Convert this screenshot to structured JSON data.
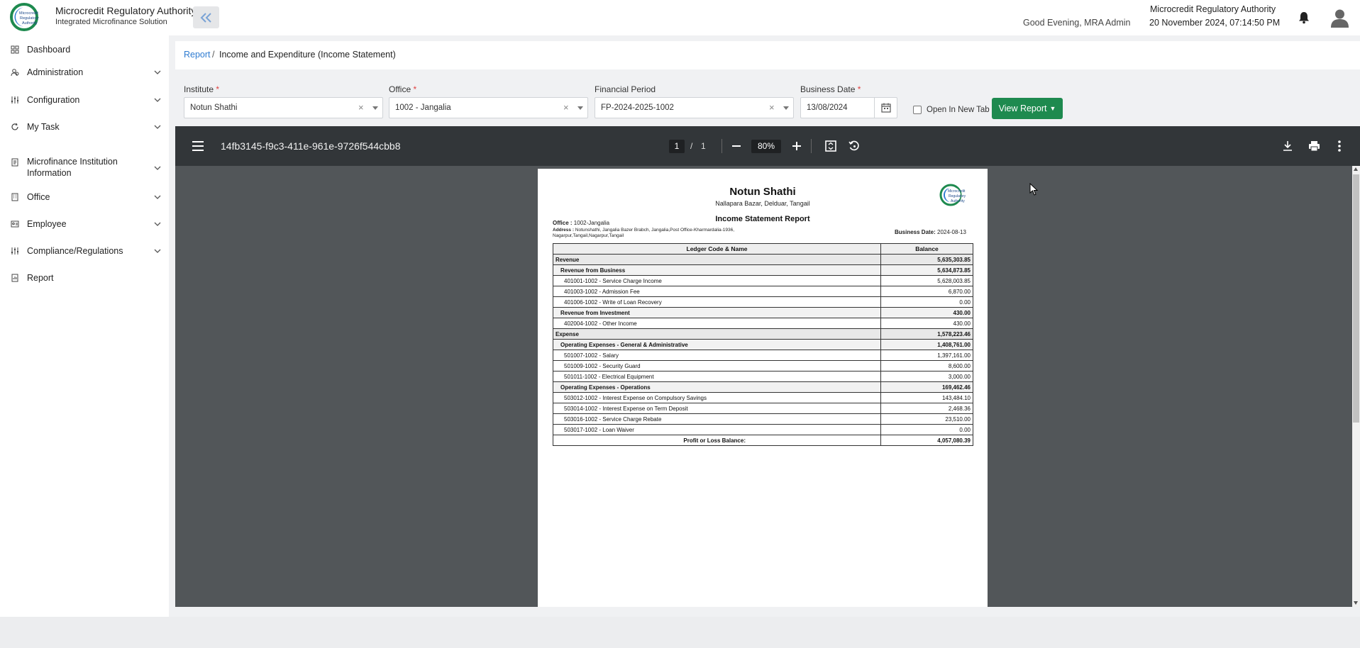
{
  "app": {
    "title": "Microcredit Regulatory Authority",
    "subtitle": "Integrated Microfinance Solution",
    "logo_text": "Microcredit Regulatory Authority"
  },
  "header": {
    "greeting": "Good Evening, MRA Admin",
    "authority": "Microcredit Regulatory Authority",
    "datetime": "20 November 2024, 07:14:50 PM"
  },
  "sidebar": {
    "items": [
      {
        "label": "Dashboard",
        "icon": "dashboard-icon",
        "has_submenu": false
      },
      {
        "label": "Administration",
        "icon": "users-icon",
        "has_submenu": true
      },
      {
        "label": "Configuration",
        "icon": "sliders-icon",
        "has_submenu": true
      },
      {
        "label": "My Task",
        "icon": "refresh-icon",
        "has_submenu": true
      },
      {
        "label": "Microfinance Institution Information",
        "icon": "document-icon",
        "has_submenu": true
      },
      {
        "label": "Office",
        "icon": "building-icon",
        "has_submenu": true
      },
      {
        "label": "Employee",
        "icon": "id-card-icon",
        "has_submenu": true
      },
      {
        "label": "Compliance/Regulations",
        "icon": "sliders-icon",
        "has_submenu": true
      },
      {
        "label": "Report",
        "icon": "report-icon",
        "has_submenu": false
      }
    ]
  },
  "breadcrumb": {
    "link": "Report",
    "separator": "/",
    "current": "Income and Expenditure (Income Statement)"
  },
  "filters": {
    "institute": {
      "label": "Institute",
      "required": "*",
      "value": "Notun Shathi"
    },
    "office": {
      "label": "Office",
      "required": "*",
      "value": "1002 - Jangalia"
    },
    "financial_period": {
      "label": "Financial Period",
      "value": "FP-2024-2025-1002"
    },
    "business_date": {
      "label": "Business Date",
      "required": "*",
      "value": "13/08/2024"
    },
    "open_new_tab": {
      "label": "Open In New Tab",
      "checked": false
    },
    "view_report": "View Report"
  },
  "viewer": {
    "doc_title": "14fb3145-f9c3-411e-961e-9726f544cbb8",
    "page_current": "1",
    "page_separator": "/",
    "page_total": "1",
    "zoom": "80%"
  },
  "report": {
    "name": "Notun Shathi",
    "address_line": "Nallapara Bazar, Delduar, Tangail",
    "title": "Income Statement Report",
    "office_label": "Office :",
    "office_value": "1002-Jangalia",
    "address_label": "Address :",
    "address_value": "Notunshathi, Jangalia Bazer Brabch, Jangalia,Post Office-Kharmardalia-1936, Nagarpur,Tangail,Nagarpur,Tangail",
    "business_date_label": "Business Date:",
    "business_date_value": "2024-08-13",
    "col_ledger": "Ledger Code & Name",
    "col_balance": "Balance",
    "rows": [
      {
        "level": 0,
        "name": "Revenue",
        "amount": "5,635,303.85"
      },
      {
        "level": 1,
        "name": "Revenue from Business",
        "amount": "5,634,873.85"
      },
      {
        "level": 2,
        "name": "401001-1002 - Service Charge Income",
        "amount": "5,628,003.85"
      },
      {
        "level": 2,
        "name": "401003-1002 - Admission Fee",
        "amount": "6,870.00"
      },
      {
        "level": 2,
        "name": "401006-1002 - Write of Loan Recovery",
        "amount": "0.00"
      },
      {
        "level": 1,
        "name": "Revenue from Investment",
        "amount": "430.00"
      },
      {
        "level": 2,
        "name": "402004-1002 - Other Income",
        "amount": "430.00"
      },
      {
        "level": 0,
        "name": "Expense",
        "amount": "1,578,223.46"
      },
      {
        "level": 1,
        "name": "Operating Expenses - General & Administrative",
        "amount": "1,408,761.00"
      },
      {
        "level": 2,
        "name": "501007-1002 - Salary",
        "amount": "1,397,161.00"
      },
      {
        "level": 2,
        "name": "501009-1002 - Security Guard",
        "amount": "8,600.00"
      },
      {
        "level": 2,
        "name": "501011-1002 - Electrical Equipment",
        "amount": "3,000.00"
      },
      {
        "level": 1,
        "name": "Operating Expenses - Operations",
        "amount": "169,462.46"
      },
      {
        "level": 2,
        "name": "503012-1002 - Interest Expense on Compulsory Savings",
        "amount": "143,484.10"
      },
      {
        "level": 2,
        "name": "503014-1002 - Interest Expense on Term Deposit",
        "amount": "2,468.36"
      },
      {
        "level": 2,
        "name": "503016-1002 - Service Charge Rebate",
        "amount": "23,510.00"
      },
      {
        "level": 2,
        "name": "503017-1002 - Loan Waiver",
        "amount": "0.00"
      }
    ],
    "total_label": "Profit or Loss Balance:",
    "total_amount": "4,057,080.39"
  },
  "colors": {
    "accent_green": "#1e8a4f",
    "link_blue": "#2e7bd1",
    "viewer_toolbar": "#323639",
    "viewer_bg": "#525659"
  }
}
